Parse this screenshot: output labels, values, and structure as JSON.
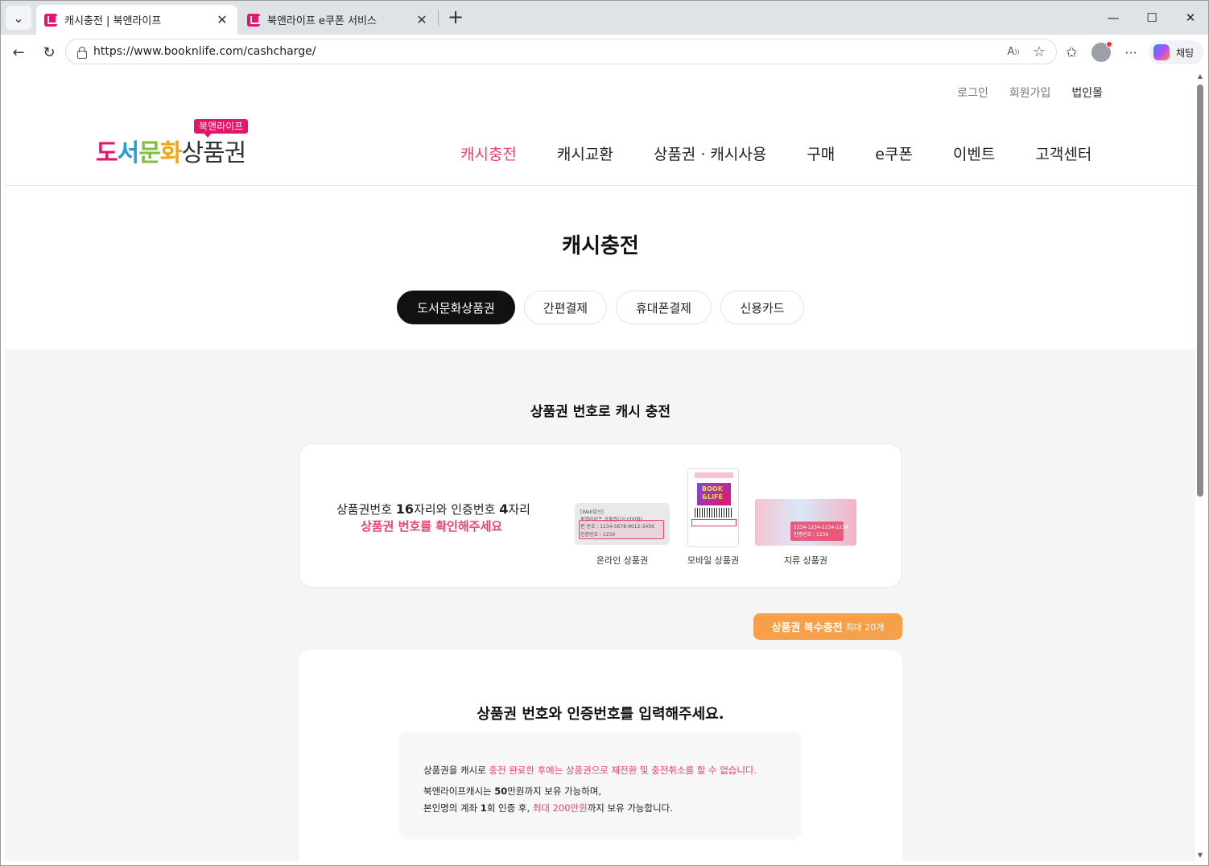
{
  "browser": {
    "tabs": [
      {
        "title": "캐시충전 | 북앤라이프",
        "active": true
      },
      {
        "title": "북앤라이프 e쿠폰 서비스",
        "active": false
      }
    ],
    "url": "https://www.booknlife.com/cashcharge/",
    "copilot_label": "채팅",
    "read_aloud_label": "A",
    "icons": {
      "tab_list": "chevron-down-icon",
      "close": "close-icon",
      "new_tab": "plus-icon",
      "minimize": "minimize-icon",
      "maximize": "maximize-icon",
      "window_close": "close-icon",
      "back": "arrow-left-icon",
      "refresh": "refresh-icon",
      "lock": "lock-icon",
      "favorite": "star-icon",
      "favorites": "favorites-list-icon",
      "more": "more-icon"
    },
    "glyphs": {
      "tab_list": "⌄",
      "close": "✕",
      "new_tab": "+",
      "minimize": "—",
      "maximize": "☐",
      "window_close": "✕",
      "back": "←",
      "refresh": "↻",
      "favorite": "☆",
      "favorites": "✩",
      "more": "···",
      "scroll_up": "▲",
      "scroll_down": "▼"
    }
  },
  "site": {
    "util_links": {
      "login": "로그인",
      "signup": "회원가입",
      "corporate": "법인몰"
    },
    "logo": {
      "badge": "북앤라이프",
      "parts": [
        "도",
        "서",
        "문",
        "화",
        "상품권"
      ]
    },
    "nav": [
      "캐시충전",
      "캐시교환",
      "상품권 · 캐시사용",
      "구매",
      "e쿠폰",
      "이벤트",
      "고객센터"
    ],
    "accent_color": "#e8456b",
    "brand_color": "#e5156b"
  },
  "page": {
    "title": "캐시충전",
    "seg_tabs": [
      "도서문화상품권",
      "간편결제",
      "휴대폰결제",
      "신용카드"
    ],
    "section_title": "상품권 번호로 캐시 충전",
    "info": {
      "line1_a": "상품권번호 ",
      "line1_b": "16",
      "line1_c": "자리와 인증번호 ",
      "line1_d": "4",
      "line1_e": "자리",
      "line2": "상품권 번호를 확인해주세요",
      "vouchers": [
        {
          "caption": "온라인 상품권",
          "lines": [
            "[Web발신]",
            "북앤라이프 상품권(10,000원)",
            "핀 번호 : 1234-5678-9012-3456",
            "인증번호 : 1234"
          ]
        },
        {
          "caption": "모바일 상품권",
          "lines": [
            "BOOK",
            "&LIFE"
          ]
        },
        {
          "caption": "지류 상품권",
          "lines": [
            "1234-1234-1234-1234",
            "인증번호 : 1234"
          ]
        }
      ]
    },
    "multi_charge": {
      "label": "상품권 복수충전",
      "sub": "최대 20개",
      "color": "#f8a049"
    },
    "form": {
      "title": "상품권 번호와 인증번호를 입력해주세요.",
      "notice": {
        "l1a": "상품권을 캐시로 ",
        "l1b": "충전 완료한 후에는 상품권으로 재전환 및 충전취소를 할 수 없습니다.",
        "l2a": "북앤라이프캐시는 ",
        "l2b": "50",
        "l2c": "만원까지 보유 가능하며,",
        "l3a": "본인명의 계좌 ",
        "l3b": "1",
        "l3c": "회 인증 후, ",
        "l3d": "최대 200만원",
        "l3e": "까지 보유 가능합니다."
      }
    }
  }
}
